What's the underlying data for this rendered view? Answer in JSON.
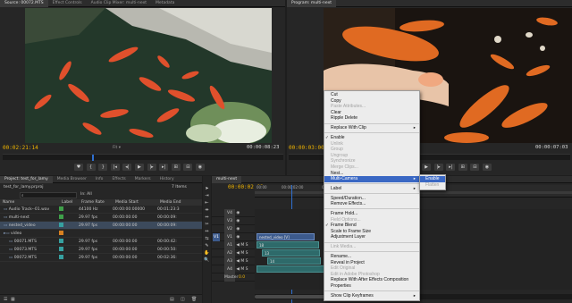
{
  "colors": {
    "timecode": "#f0b400",
    "menu_highlight": "#3a68c4",
    "clip_blue": "#3c5a8c",
    "clip_teal": "#2e6a6a",
    "label_green": "#3fa04a",
    "label_teal": "#36a0a0",
    "label_orange": "#d88020"
  },
  "source_monitor": {
    "tabs": [
      "Source: 00072.MTS",
      "Effect Controls",
      "Audio Clip Mixer: multi-next",
      "Metadata"
    ],
    "timecode_in": "00:02:21:14",
    "timecode_out": "00:00:08:23",
    "zoom": "Fit"
  },
  "program_monitor": {
    "tabs": [
      "Program: multi-next"
    ],
    "timecode_in": "00:00:03:00",
    "timecode_out": "00:00:07:03"
  },
  "project_panel": {
    "tabs": [
      "Project: test_for_lamy",
      "Media Browser",
      "Info",
      "Effects",
      "Markers",
      "History"
    ],
    "project_file": "test_for_lamy.prproj",
    "item_count": "7 Items",
    "in_label": "In:",
    "in_value": "All",
    "columns": [
      "Name",
      "Label",
      "Frame Rate",
      "Media Start",
      "Media End"
    ],
    "rows": [
      {
        "name": "Audio Track--01.wav",
        "rate": "44100 Hz",
        "start": "00:00:00:00000",
        "end": "00:01:23:3",
        "color": "#3fa04a"
      },
      {
        "name": "multi-next",
        "rate": "29.97 fps",
        "start": "00:00:00:00",
        "end": "00:00:09:",
        "color": "#3fa04a"
      },
      {
        "name": "nested_video",
        "rate": "29.97 fps",
        "start": "00:00:00:00",
        "end": "00:00:09:",
        "color": "#36a0a0"
      },
      {
        "name": "video",
        "rate": "",
        "start": "",
        "end": "",
        "color": "#d88020"
      },
      {
        "name": "00071.MTS",
        "rate": "29.97 fps",
        "start": "00:00:00:00",
        "end": "00:00:42:",
        "color": "#36a0a0"
      },
      {
        "name": "00073.MTS",
        "rate": "29.97 fps",
        "start": "00:00:00:00",
        "end": "00:00:50:",
        "color": "#36a0a0"
      },
      {
        "name": "00072.MTS",
        "rate": "29.97 fps",
        "start": "00:00:00:00",
        "end": "00:02:36:",
        "color": "#36a0a0"
      }
    ]
  },
  "timeline": {
    "tab": "multi-next",
    "timecode": "00:00:02:02",
    "ruler": [
      "00:00",
      "00:00:02:00",
      "00:00:04:00"
    ],
    "tracks": [
      "V4",
      "V3",
      "V2",
      "V1",
      "A1",
      "A2",
      "A3",
      "A4",
      "Master"
    ],
    "master_value": "0.0",
    "clips": {
      "video": "nested_video [V]",
      "a1": "18",
      "a2": "13",
      "a3": "14"
    }
  },
  "context_menu": {
    "items": [
      {
        "label": "Cut",
        "state": "normal"
      },
      {
        "label": "Copy",
        "state": "normal"
      },
      {
        "label": "Paste Attributes...",
        "state": "disabled"
      },
      {
        "label": "Clear",
        "state": "normal"
      },
      {
        "label": "Ripple Delete",
        "state": "normal"
      },
      {
        "sep": true
      },
      {
        "label": "Replace With Clip",
        "state": "normal",
        "submenu": true
      },
      {
        "sep": true
      },
      {
        "label": "Enable",
        "state": "checked"
      },
      {
        "label": "Unlink",
        "state": "disabled"
      },
      {
        "label": "Group",
        "state": "disabled"
      },
      {
        "label": "Ungroup",
        "state": "disabled"
      },
      {
        "label": "Synchronize",
        "state": "disabled"
      },
      {
        "label": "Merge Clips...",
        "state": "disabled"
      },
      {
        "label": "Nest...",
        "state": "normal"
      },
      {
        "label": "Multi-Camera",
        "state": "highlighted",
        "submenu": true
      },
      {
        "sep": true
      },
      {
        "label": "Label",
        "state": "normal",
        "submenu": true
      },
      {
        "sep": true
      },
      {
        "label": "Speed/Duration...",
        "state": "normal"
      },
      {
        "label": "Remove Effects...",
        "state": "normal"
      },
      {
        "sep": true
      },
      {
        "label": "Frame Hold...",
        "state": "normal"
      },
      {
        "label": "Field Options...",
        "state": "disabled"
      },
      {
        "label": "Frame Blend",
        "state": "checked"
      },
      {
        "label": "Scale to Frame Size",
        "state": "normal"
      },
      {
        "label": "Adjustment Layer",
        "state": "normal"
      },
      {
        "sep": true
      },
      {
        "label": "Link Media...",
        "state": "disabled"
      },
      {
        "sep": true
      },
      {
        "label": "Rename...",
        "state": "normal"
      },
      {
        "label": "Reveal in Project",
        "state": "normal"
      },
      {
        "label": "Edit Original",
        "state": "disabled"
      },
      {
        "label": "Edit in Adobe Photoshop",
        "state": "disabled"
      },
      {
        "label": "Replace With After Effects Composition",
        "state": "normal"
      },
      {
        "label": "Properties",
        "state": "normal"
      },
      {
        "sep": true
      },
      {
        "label": "Show Clip Keyframes",
        "state": "normal",
        "submenu": true
      }
    ],
    "submenu": [
      {
        "label": "Enable",
        "state": "highlighted"
      },
      {
        "label": "Flatten",
        "state": "disabled"
      }
    ]
  }
}
